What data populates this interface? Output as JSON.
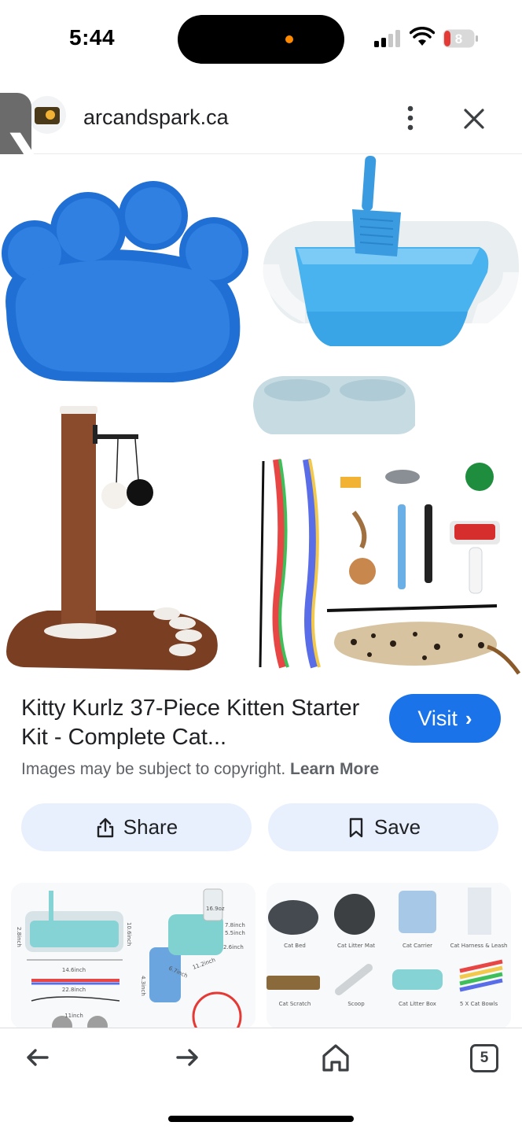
{
  "status_bar": {
    "time": "5:44",
    "battery": "8"
  },
  "browser": {
    "domain": "arcandspark.ca",
    "tabs_count": "5"
  },
  "product": {
    "title": "Kitty Kurlz 37-Piece Kitten Starter Kit - Complete Cat...",
    "visit_label": "Visit",
    "copyright_text": "Images may be subject to copyright.",
    "learn_more": "Learn More"
  },
  "actions": {
    "share_label": "Share",
    "save_label": "Save"
  },
  "related_left": {
    "dims": [
      "16.9oz",
      "7.8inch",
      "5.5inch",
      "2.6inch",
      "10.6inch",
      "14.6inch",
      "22.8inch",
      "11inch",
      "11.2inch",
      "4.3inch",
      "6.7inch",
      "2.8inch"
    ]
  },
  "related_right": {
    "labels": [
      "Cat Bed",
      "Cat Litter Mat",
      "Cat Carrier",
      "Cat Harness & Leash",
      "Cat Scratch",
      "Scoop",
      "Cat Litter Box",
      "5 X Cat Bowls"
    ]
  },
  "colors": {
    "accent": "#1a73e8",
    "button_bg": "#e8f0fe",
    "status_dot": "#ff8a00"
  },
  "icons": [
    "back-arrow-icon",
    "forward-arrow-icon",
    "home-icon",
    "share-icon",
    "bookmark-icon",
    "close-icon",
    "more-vert-icon"
  ]
}
